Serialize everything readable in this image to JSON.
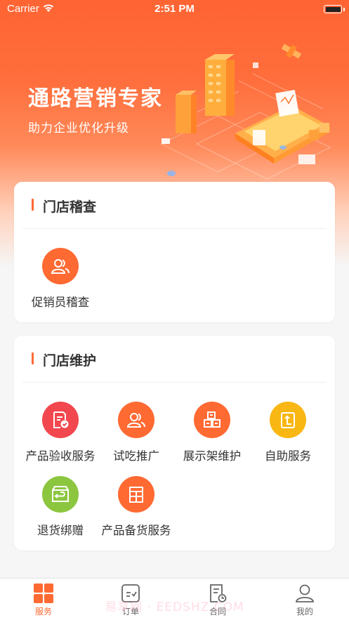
{
  "status": {
    "carrier": "Carrier",
    "time": "2:51 PM"
  },
  "hero": {
    "title": "通路营销专家",
    "subtitle": "助力企业优化升级"
  },
  "sections": {
    "inspection": {
      "title": "门店稽查",
      "items": [
        {
          "label": "促销员稽查",
          "icon": "people-icon"
        }
      ]
    },
    "maintenance": {
      "title": "门店维护",
      "items": [
        {
          "label": "产品验收服务",
          "icon": "document-check-icon"
        },
        {
          "label": "试吃推广",
          "icon": "people-icon"
        },
        {
          "label": "展示架维护",
          "icon": "boxes-icon"
        },
        {
          "label": "自助服务",
          "icon": "refresh-card-icon"
        },
        {
          "label": "退货绑赠",
          "icon": "return-box-icon"
        },
        {
          "label": "产品备货服务",
          "icon": "shelf-icon"
        }
      ]
    }
  },
  "tabbar": {
    "tabs": [
      {
        "label": "服务",
        "icon": "grid-icon",
        "active": true
      },
      {
        "label": "订单",
        "icon": "order-icon",
        "active": false
      },
      {
        "label": "合同",
        "icon": "contract-icon",
        "active": false
      },
      {
        "label": "我的",
        "icon": "user-icon",
        "active": false
      }
    ]
  },
  "watermark": "易享网 · EEDSHZ.COM",
  "colors": {
    "accent": "#ff6a33",
    "red": "#f2474e",
    "yellow": "#f8b713",
    "green": "#8cc63f"
  }
}
